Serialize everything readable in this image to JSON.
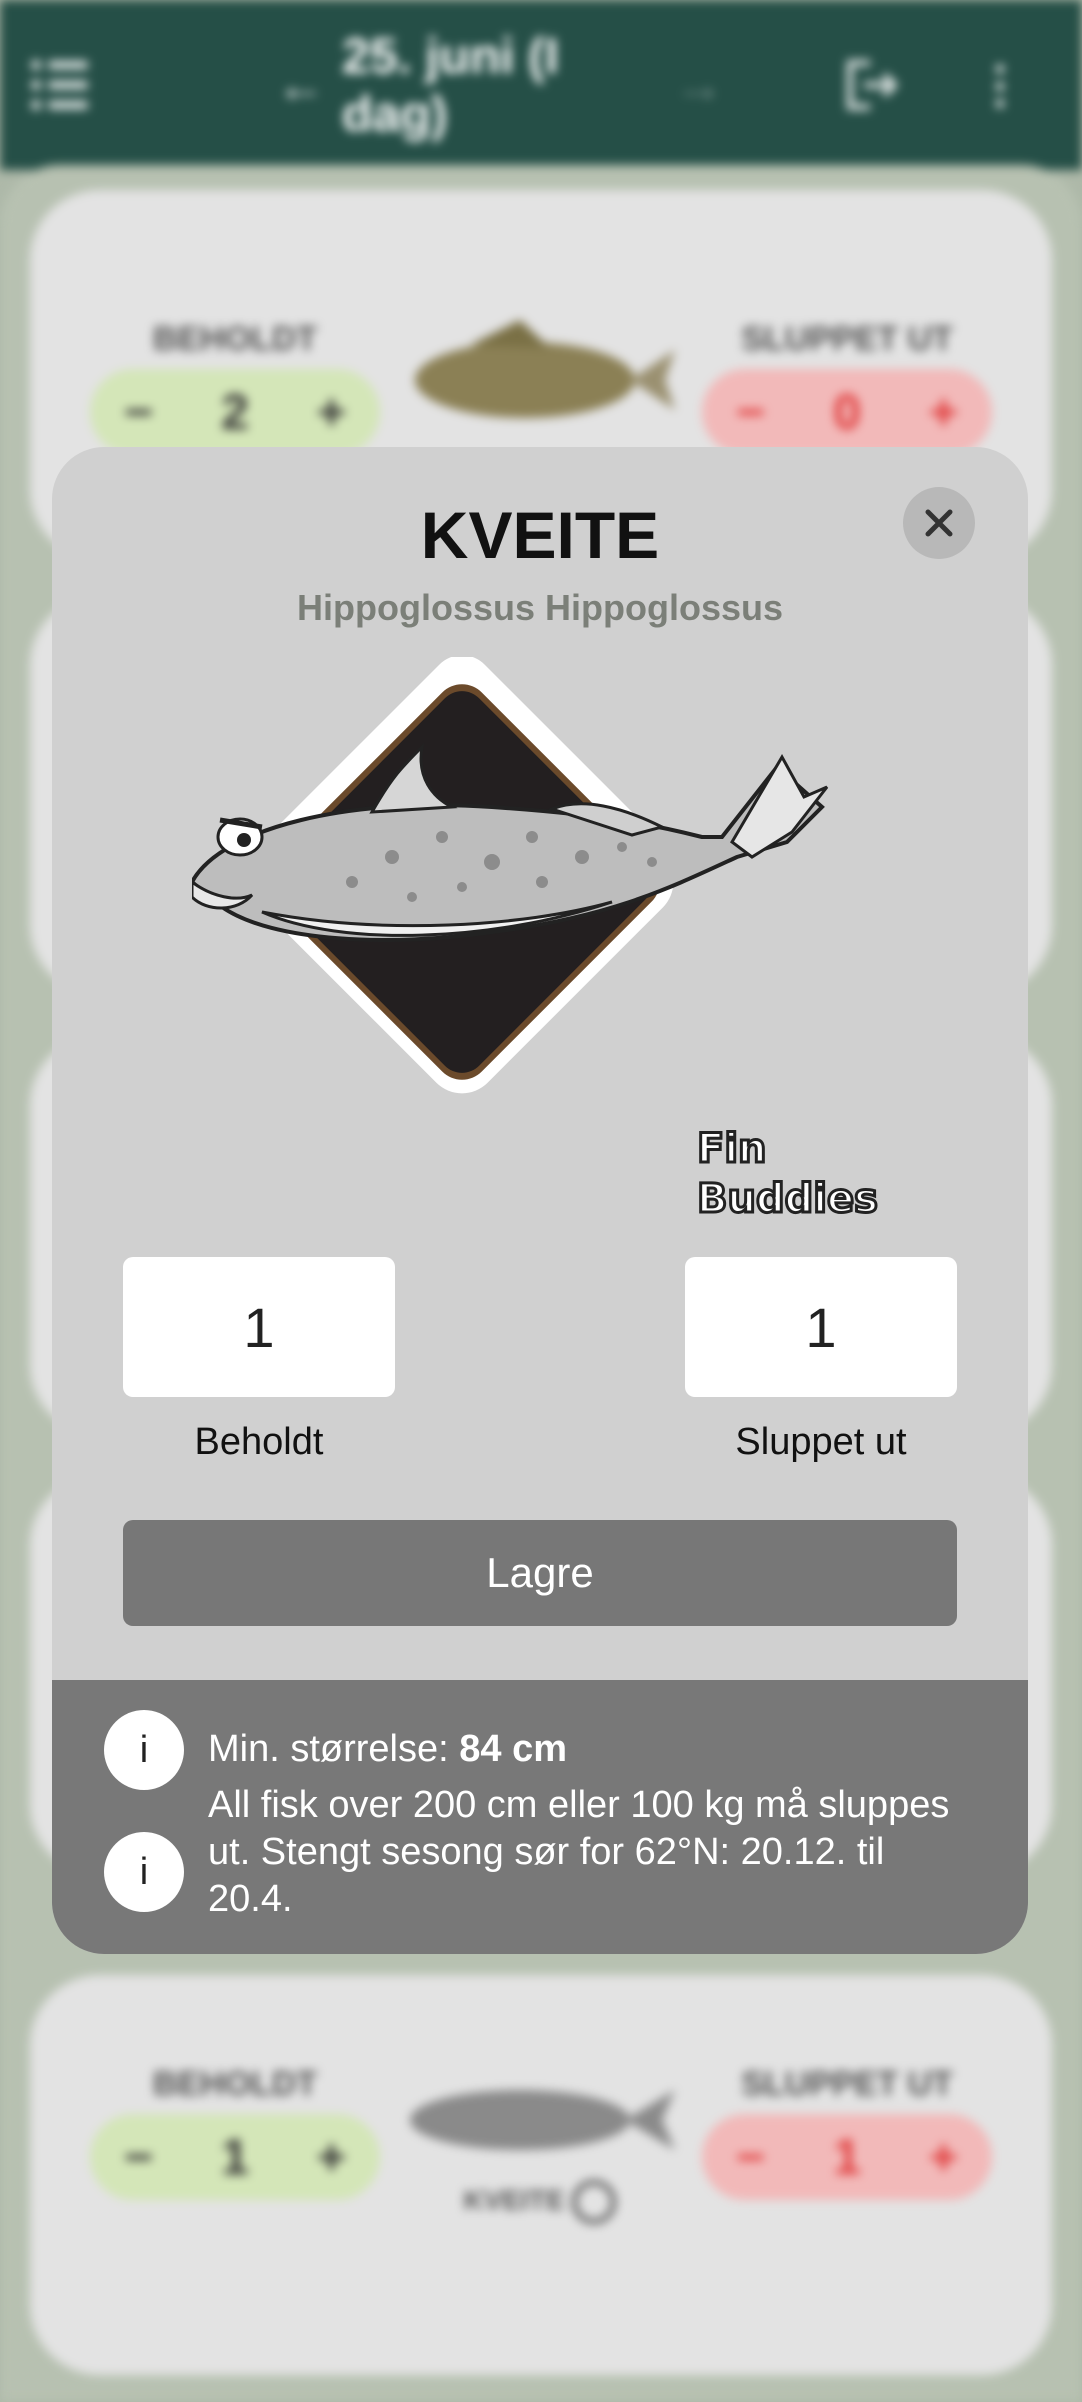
{
  "topbar": {
    "date_label": "25. juni (I dag)",
    "prev_arrow": "←",
    "next_arrow": "→",
    "more_glyph": "⋮"
  },
  "cards": [
    {
      "keep_label": "BEHOLDT",
      "keep_count": "2",
      "release_label": "SLUPPET UT",
      "release_count": "0"
    },
    {
      "keep_label": "BEHOLDT",
      "keep_count": "1",
      "release_label": "SLUPPET UT",
      "release_count": "1",
      "fish_name": "KVEITE"
    }
  ],
  "counter": {
    "minus": "−",
    "plus": "+"
  },
  "modal": {
    "title": "KVEITE",
    "latin_name": "Hippoglossus Hippoglossus",
    "close_glyph": "✕",
    "brand": [
      "Fin",
      "Buddies"
    ],
    "kept_value": "1",
    "kept_label": "Beholdt",
    "released_value": "1",
    "released_label": "Sluppet ut",
    "save_label": "Lagre",
    "info": [
      {
        "icon": "i",
        "prefix": "Min. størrelse: ",
        "value": "84 cm"
      },
      {
        "icon": "i",
        "text": "All fisk over 200 cm eller 100 kg må sluppes ut. Stengt sesong sør for 62°N: 20.12. til 20.4."
      }
    ]
  },
  "colors": {
    "header": "#254f47",
    "keep_bg": "#d4e6b8",
    "release_bg": "#f2b9b9",
    "release_text": "#e03b3b",
    "save_button": "#777777",
    "info_panel": "#787878"
  }
}
